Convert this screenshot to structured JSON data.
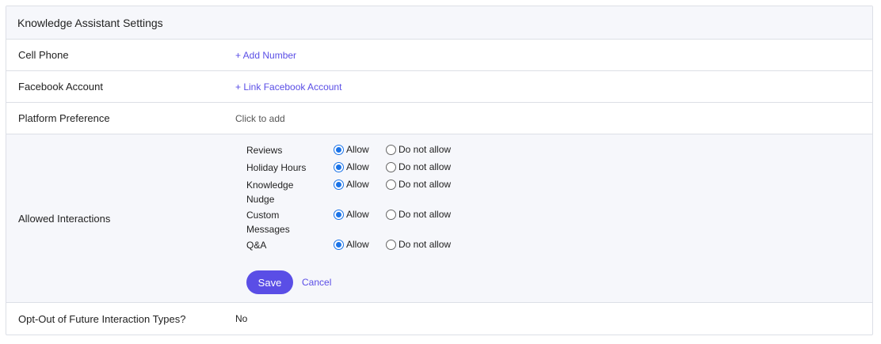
{
  "header": {
    "title": "Knowledge Assistant Settings"
  },
  "rows": {
    "cell_phone": {
      "label": "Cell Phone",
      "action": "+ Add Number"
    },
    "facebook": {
      "label": "Facebook Account",
      "action": "+ Link Facebook Account"
    },
    "platform": {
      "label": "Platform Preference",
      "value": "Click to add"
    },
    "allowed": {
      "label": "Allowed Interactions",
      "allow_label": "Allow",
      "deny_label": "Do not allow",
      "items": [
        {
          "name": "Reviews",
          "selected": "allow"
        },
        {
          "name": "Holiday Hours",
          "selected": "allow"
        },
        {
          "name": "Knowledge Nudge",
          "selected": "allow"
        },
        {
          "name": "Custom Messages",
          "selected": "allow"
        },
        {
          "name": "Q&A",
          "selected": "allow"
        }
      ],
      "save_label": "Save",
      "cancel_label": "Cancel"
    },
    "opt_out": {
      "label": "Opt-Out of Future Interaction Types?",
      "value": "No"
    }
  },
  "colors": {
    "accent": "#5a4ee6",
    "radio": "#1a73e8",
    "header_bg": "#f6f7fb",
    "border": "#dcdfe6"
  }
}
